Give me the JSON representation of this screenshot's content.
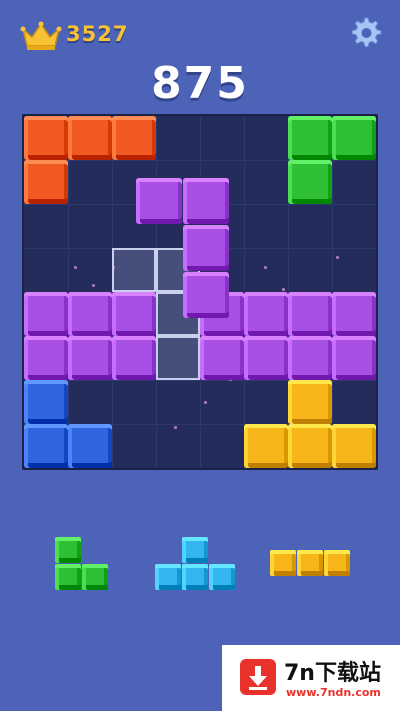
{
  "header": {
    "best_score": "3527",
    "crown_icon": "crown-icon",
    "settings_icon": "gear-icon"
  },
  "score": "875",
  "colors": {
    "background": "#4d63b8",
    "board": "#232c5a",
    "orange": "#f05a22",
    "green": "#2fbf35",
    "purple": "#a84fe6",
    "blue": "#2f66e0",
    "yellow": "#f6b619",
    "cyan": "#33b5ef"
  },
  "board": {
    "rows": 8,
    "cols": 8,
    "blocks": [
      {
        "row": 0,
        "col": 0,
        "color": "orange"
      },
      {
        "row": 0,
        "col": 1,
        "color": "orange"
      },
      {
        "row": 0,
        "col": 2,
        "color": "orange"
      },
      {
        "row": 1,
        "col": 0,
        "color": "orange"
      },
      {
        "row": 0,
        "col": 6,
        "color": "green"
      },
      {
        "row": 0,
        "col": 7,
        "color": "green"
      },
      {
        "row": 1,
        "col": 6,
        "color": "green"
      },
      {
        "row": 4,
        "col": 0,
        "color": "purple"
      },
      {
        "row": 4,
        "col": 1,
        "color": "purple"
      },
      {
        "row": 4,
        "col": 2,
        "color": "purple"
      },
      {
        "row": 4,
        "col": 4,
        "color": "purple"
      },
      {
        "row": 4,
        "col": 5,
        "color": "purple"
      },
      {
        "row": 4,
        "col": 6,
        "color": "purple"
      },
      {
        "row": 4,
        "col": 7,
        "color": "purple"
      },
      {
        "row": 5,
        "col": 0,
        "color": "purple"
      },
      {
        "row": 5,
        "col": 1,
        "color": "purple"
      },
      {
        "row": 5,
        "col": 2,
        "color": "purple"
      },
      {
        "row": 5,
        "col": 4,
        "color": "purple"
      },
      {
        "row": 5,
        "col": 5,
        "color": "purple"
      },
      {
        "row": 5,
        "col": 6,
        "color": "purple"
      },
      {
        "row": 5,
        "col": 7,
        "color": "purple"
      },
      {
        "row": 6,
        "col": 0,
        "color": "blue"
      },
      {
        "row": 7,
        "col": 0,
        "color": "blue"
      },
      {
        "row": 7,
        "col": 1,
        "color": "blue"
      },
      {
        "row": 6,
        "col": 6,
        "color": "yellow"
      },
      {
        "row": 7,
        "col": 5,
        "color": "yellow"
      },
      {
        "row": 7,
        "col": 6,
        "color": "yellow"
      },
      {
        "row": 7,
        "col": 7,
        "color": "yellow"
      }
    ],
    "ghost_cells": [
      {
        "row": 3,
        "col": 2
      },
      {
        "row": 3,
        "col": 3
      },
      {
        "row": 4,
        "col": 3
      },
      {
        "row": 5,
        "col": 3
      }
    ],
    "dragging_piece": {
      "color": "purple",
      "cells": [
        {
          "r": 0,
          "c": 0
        },
        {
          "r": 0,
          "c": 1
        },
        {
          "r": 1,
          "c": 1
        },
        {
          "r": 2,
          "c": 1
        }
      ]
    }
  },
  "tray": [
    {
      "name": "tray-piece-green-l",
      "color": "green",
      "cells": [
        {
          "r": 0,
          "c": 0
        },
        {
          "r": 1,
          "c": 0
        },
        {
          "r": 1,
          "c": 1
        }
      ]
    },
    {
      "name": "tray-piece-cyan-t",
      "color": "cyan",
      "cells": [
        {
          "r": 0,
          "c": 1
        },
        {
          "r": 1,
          "c": 0
        },
        {
          "r": 1,
          "c": 1
        },
        {
          "r": 1,
          "c": 2
        }
      ]
    },
    {
      "name": "tray-piece-yellow-i3",
      "color": "yellow",
      "cells": [
        {
          "r": 0,
          "c": 0
        },
        {
          "r": 0,
          "c": 1
        },
        {
          "r": 0,
          "c": 2
        }
      ]
    }
  ],
  "watermark": {
    "title": "7n下载站",
    "url": "www.7ndn.com"
  }
}
